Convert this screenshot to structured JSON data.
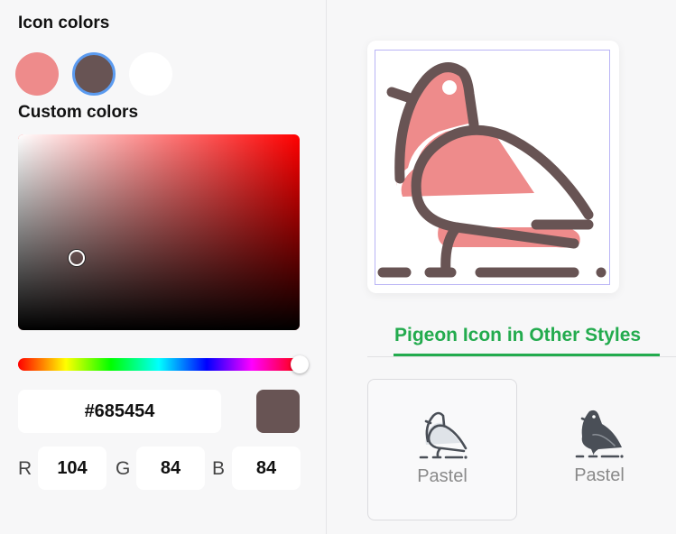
{
  "left_panel": {
    "icon_colors_title": "Icon colors",
    "swatches": [
      {
        "name": "pink",
        "color": "#ee8b8b",
        "selected": false
      },
      {
        "name": "dark-brown",
        "color": "#685454",
        "selected": true
      },
      {
        "name": "white",
        "color": "#ffffff",
        "selected": false
      }
    ],
    "custom_colors_title": "Custom colors",
    "picker": {
      "hue_color": "#ff0000",
      "saturation": 0.21,
      "value": 0.41,
      "hue": 0
    },
    "hex_value": "#685454",
    "preview_color": "#685454",
    "rgb": {
      "r_label": "R",
      "r_value": "104",
      "g_label": "G",
      "g_value": "84",
      "b_label": "B",
      "b_value": "84"
    }
  },
  "icon_preview": {
    "icon": "pigeon-icon",
    "stroke_color": "#685454",
    "fill_color": "#ee8b8b"
  },
  "other_styles": {
    "title": "Pigeon Icon in Other Styles",
    "accent_color": "#23ab4e",
    "items": [
      {
        "label": "Pastel",
        "icon": "pigeon-pastel-icon",
        "active": true
      },
      {
        "label": "Pastel",
        "icon": "pigeon-solid-icon",
        "active": false
      }
    ]
  }
}
